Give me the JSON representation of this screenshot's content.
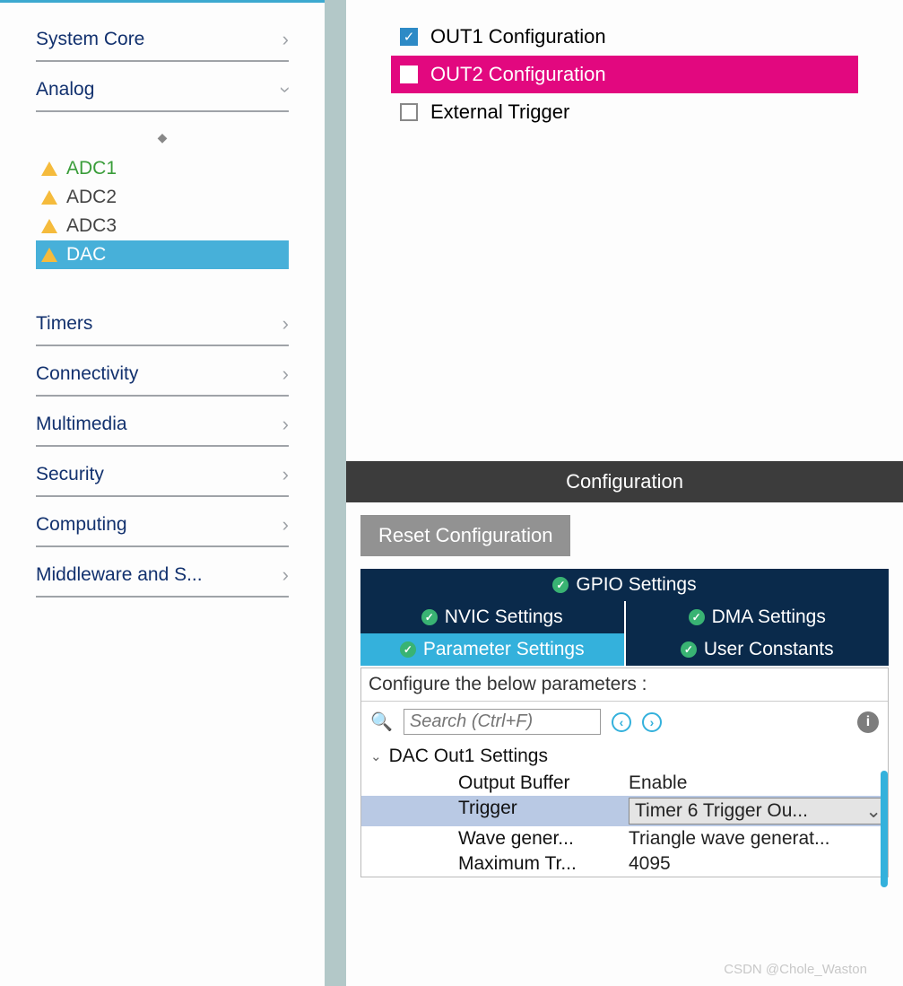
{
  "sidebar": {
    "categories": {
      "system_core": "System Core",
      "analog": "Analog",
      "timers": "Timers",
      "connectivity": "Connectivity",
      "multimedia": "Multimedia",
      "security": "Security",
      "computing": "Computing",
      "middleware": "Middleware and S..."
    },
    "analog_items": {
      "adc1": "ADC1",
      "adc2": "ADC2",
      "adc3": "ADC3",
      "dac": "DAC"
    }
  },
  "mode": {
    "out1": "OUT1 Configuration",
    "out2": "OUT2 Configuration",
    "ext": "External Trigger"
  },
  "config": {
    "header": "Configuration",
    "reset": "Reset Configuration",
    "tabs": {
      "gpio": "GPIO Settings",
      "nvic": "NVIC Settings",
      "dma": "DMA Settings",
      "param": "Parameter Settings",
      "user": "User Constants"
    },
    "desc": "Configure the below parameters :",
    "search_placeholder": "Search (Ctrl+F)",
    "section": "DAC Out1 Settings",
    "params": {
      "output_buffer": {
        "k": "Output Buffer",
        "v": "Enable"
      },
      "trigger": {
        "k": "Trigger",
        "v": "Timer 6 Trigger Ou..."
      },
      "wave": {
        "k": "Wave gener...",
        "v": "Triangle wave generat..."
      },
      "max": {
        "k": "Maximum Tr...",
        "v": "4095"
      }
    }
  },
  "watermark": "CSDN @Chole_Waston"
}
